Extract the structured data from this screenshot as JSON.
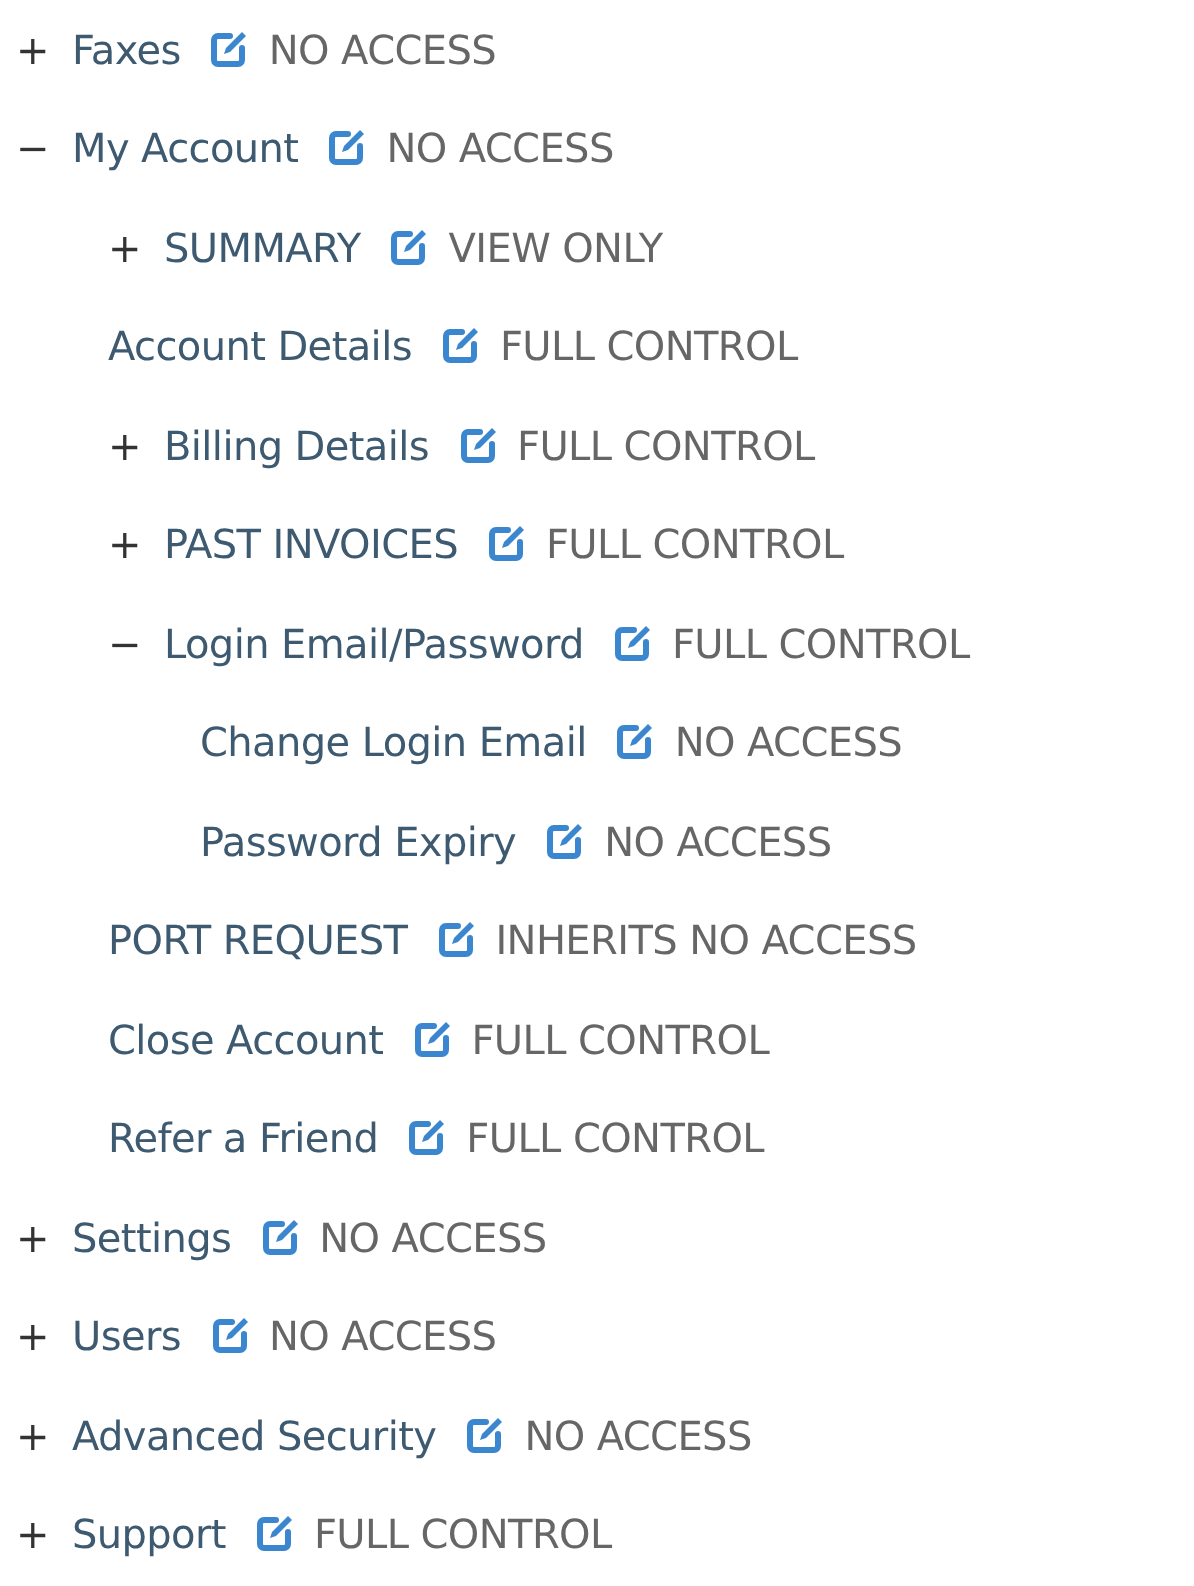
{
  "tree": [
    {
      "toggle": "+",
      "label": "Faxes",
      "permission": "NO ACCESS"
    },
    {
      "toggle": "−",
      "label": "My Account",
      "permission": "NO ACCESS",
      "children": [
        {
          "toggle": "+",
          "label": "SUMMARY",
          "permission": "VIEW ONLY"
        },
        {
          "label": "Account Details",
          "permission": "FULL CONTROL"
        },
        {
          "toggle": "+",
          "label": "Billing Details",
          "permission": "FULL CONTROL"
        },
        {
          "toggle": "+",
          "label": "PAST INVOICES",
          "permission": "FULL CONTROL"
        },
        {
          "toggle": "−",
          "label": "Login Email/Password",
          "permission": "FULL CONTROL",
          "children": [
            {
              "label": "Change Login Email",
              "permission": "NO ACCESS"
            },
            {
              "label": "Password Expiry",
              "permission": "NO ACCESS"
            }
          ]
        },
        {
          "label": "PORT REQUEST",
          "permission": "INHERITS NO ACCESS"
        },
        {
          "label": "Close Account",
          "permission": "FULL CONTROL"
        },
        {
          "label": "Refer a Friend",
          "permission": "FULL CONTROL"
        }
      ]
    },
    {
      "toggle": "+",
      "label": "Settings",
      "permission": "NO ACCESS"
    },
    {
      "toggle": "+",
      "label": "Users",
      "permission": "NO ACCESS"
    },
    {
      "toggle": "+",
      "label": "Advanced Security",
      "permission": "NO ACCESS"
    },
    {
      "toggle": "+",
      "label": "Support",
      "permission": "FULL CONTROL"
    }
  ]
}
